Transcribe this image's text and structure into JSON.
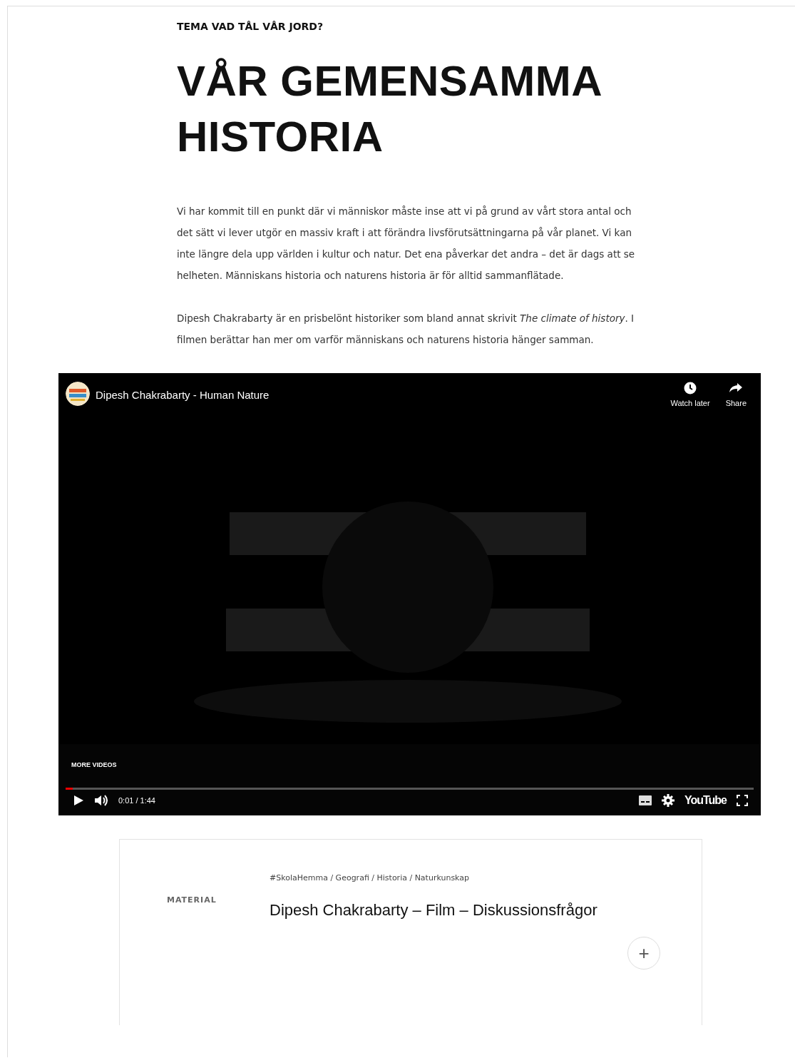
{
  "kicker": "TEMA VAD TÅL VÅR JORD?",
  "title": "VÅR GEMENSAMMA HISTORIA",
  "paragraphs": [
    "Vi har kommit till en punkt där vi människor måste inse att vi på grund av vårt stora antal och det sätt vi lever utgör en massiv kraft i att förändra livsförutsättningarna på vår planet. Vi kan inte längre dela upp världen i kultur och natur. Det ena påverkar det andra – det är dags att se helheten. Människans historia och naturens historia är för alltid sammanflätade.",
    "Dipesh Chakrabarty är en prisbelönt historiker som bland annat skrivit *The climate of history*. I filmen berättar han mer om varför människans och naturens historia hänger samman."
  ],
  "video": {
    "kind": "picture",
    "title": "Dipesh Chakrabarty - Human Nature",
    "actions": [
      "Watch later",
      "Share"
    ],
    "more_videos": "MORE VIDEOS",
    "time": "0:01 / 1:44",
    "progress": {
      "level": 0.01
    },
    "logo": "YouTube"
  },
  "material": {
    "label": "MATERIAL",
    "tags": "#SkolaHemma / Geografi / Historia / Naturkunskap",
    "title": "Dipesh Chakrabarty – Film – Diskussionsfrågor",
    "expand": "+"
  }
}
